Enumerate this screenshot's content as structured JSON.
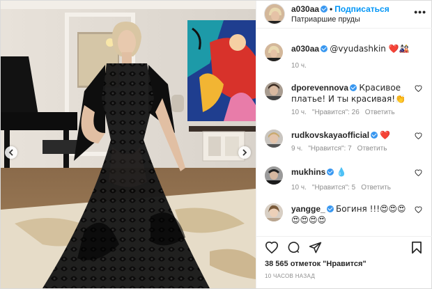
{
  "post": {
    "username": "a030aa",
    "follow_label": "Подписаться",
    "location": "Патриаршие пруды",
    "more_label": "•••"
  },
  "caption": {
    "username": "a030aa",
    "text": "@vyudashkin ❤️🎎",
    "time": "10 ч."
  },
  "comments": [
    {
      "username": "dporevennova",
      "verified": true,
      "text": "Красивое платье! И ты красивая!👏",
      "time": "10 ч.",
      "likes": "\"Нравится\": 26",
      "reply": "Ответить"
    },
    {
      "username": "rudkovskayaofficial",
      "verified": true,
      "text": "❤️",
      "time": "9 ч.",
      "likes": "\"Нравится\": 7",
      "reply": "Ответить"
    },
    {
      "username": "mukhins",
      "verified": true,
      "text": "💧",
      "time": "10 ч.",
      "likes": "\"Нравится\": 5",
      "reply": "Ответить"
    },
    {
      "username": "yangge_",
      "verified": true,
      "text": "Богиня !!!😍😍😍😍😍😍😍",
      "time": "",
      "likes": "",
      "reply": ""
    }
  ],
  "footer": {
    "likes_count": "38 565 отметок \"Нравится\"",
    "timestamp": "10 ЧАСОВ НАЗАД"
  },
  "icons": [
    "heart-icon",
    "comment-icon",
    "share-icon",
    "bookmark-icon",
    "chevron-left-icon",
    "chevron-right-icon",
    "verified-icon"
  ],
  "colors": {
    "accent": "#0095f6",
    "verified": "#3897f0",
    "muted": "#8e8e8e",
    "text": "#262626"
  }
}
